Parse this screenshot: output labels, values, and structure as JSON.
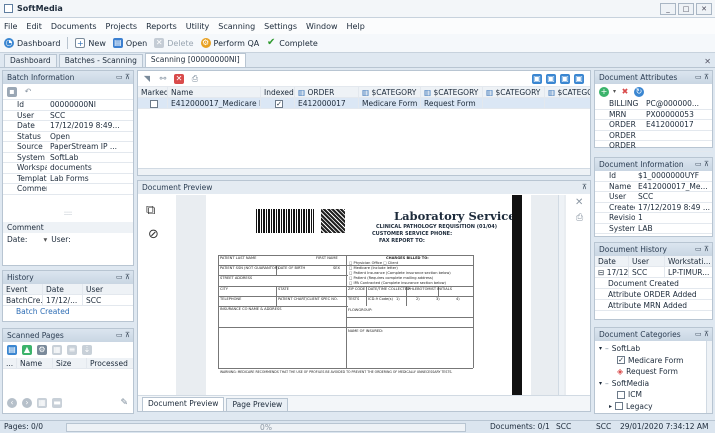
{
  "app": {
    "title": "SoftMedia"
  },
  "window_buttons": [
    "_",
    "□",
    "✕"
  ],
  "menu": [
    "File",
    "Edit",
    "Documents",
    "Projects",
    "Reports",
    "Utility",
    "Scanning",
    "Settings",
    "Window",
    "Help"
  ],
  "toolbar": {
    "dashboard": "Dashboard",
    "new": "New",
    "open": "Open",
    "delete": "Delete",
    "perform_qa": "Perform QA",
    "complete": "Complete"
  },
  "tabs": [
    "Dashboard",
    "Batches - Scanning",
    "Scanning [00000000NI]"
  ],
  "batch_info": {
    "title": "Batch Information",
    "rows": [
      {
        "k": "Id",
        "v": "00000000NI"
      },
      {
        "k": "User",
        "v": "SCC"
      },
      {
        "k": "Date",
        "v": "17/12/2019 8:49..."
      },
      {
        "k": "Status",
        "v": "Open"
      },
      {
        "k": "Source",
        "v": "PaperStream IP ..."
      },
      {
        "k": "System",
        "v": "SoftLab"
      },
      {
        "k": "Workspace",
        "v": "documents"
      },
      {
        "k": "Template",
        "v": "Lab Forms"
      },
      {
        "k": "Comment",
        "v": ""
      }
    ],
    "comment_label": "Comment",
    "date_label": "Date:",
    "user_label": "User:"
  },
  "history": {
    "title": "History",
    "columns": [
      "Event",
      "Date",
      "User"
    ],
    "rows": [
      {
        "event": "BatchCre...",
        "date": "17/12/...",
        "user": "SCC"
      }
    ],
    "sub": "Batch Created"
  },
  "scanned_pages": {
    "title": "Scanned Pages",
    "columns": [
      "...",
      "Name",
      "Size",
      "Processed"
    ]
  },
  "doc_grid": {
    "columns": [
      "Marked",
      "Name",
      "Indexed",
      "ORDER",
      "$CATEGORY",
      "$CATEGORY",
      "$CATEGORY",
      "$CATEGORY"
    ],
    "row": {
      "name": "E412000017_Medicare For...",
      "order": "E412000017",
      "cat1": "Medicare Form",
      "cat2": "Request Form"
    }
  },
  "preview": {
    "title": "Document Preview",
    "form": {
      "heading": "Laboratory Services",
      "sub1": "CLINICAL PATHOLOGY REQUISITION (01/04)",
      "sub2": "CUSTOMER SERVICE PHONE:",
      "sub3": "FAX REPORT TO:",
      "f_patient_last": "PATIENT LAST NAME",
      "f_first": "FIRST NAME",
      "f_charges": "CHARGES BILLED TO:",
      "f_ssn": "PATIENT SSN (NOT GUARANTOR)",
      "f_dob": "DATE OF BIRTH",
      "f_sex": "SEX",
      "f_street": "STREET ADDRESS",
      "f_city": "CITY",
      "f_state": "STATE",
      "f_zip": "ZIP CODE",
      "f_datetime": "DATE/TIME COLLECTED",
      "f_phleb": "PHLEBOTOMIST INITIALS",
      "f_phone": "TELEPHONE",
      "f_chart": "PATIENT CHART/CLIENT SPEC NO.",
      "f_tests": "TESTS",
      "f_icd": "ICD-9 Code(s)",
      "f_insurance": "INSURANCE CO NAME & ADDRESS",
      "f_flowgroup": "FLOWGROUP:",
      "f_insured": "NAME OF INSURED:",
      "footer": "WARNING: MEDICARE RECOMMENDS THAT THE USE OF PROFILES BE AVOIDED TO PREVENT THE ORDERING OF MEDICALLY UNNECESSARY TESTS.",
      "cb1": "Physician Office",
      "cb1b": "Client",
      "cb2": "Medicare (Include letter)",
      "cb3": "Patient Insurance (Complete insurance section below)",
      "cb4": "Patient (Requires complete mailing address)",
      "cb5": "IPA Contracted (Complete insurance section below)",
      "i1": "1)",
      "i2": "2)",
      "i3": "3)",
      "i4": "4)"
    },
    "bottom_tabs": [
      "Document Preview",
      "Page Preview"
    ]
  },
  "doc_attributes": {
    "title": "Document Attributes",
    "rows": [
      {
        "k": "BILLING",
        "v": "PC@000000..."
      },
      {
        "k": "MRN",
        "v": "PX00000053"
      },
      {
        "k": "ORDER",
        "v": "E412000017"
      },
      {
        "k": "ORDER",
        "v": ""
      },
      {
        "k": "ORDER",
        "v": ""
      }
    ]
  },
  "doc_info": {
    "title": "Document Information",
    "rows": [
      {
        "k": "Id",
        "v": "$1_0000000UYF"
      },
      {
        "k": "Name",
        "v": "E412000017_Me..."
      },
      {
        "k": "User",
        "v": "SCC"
      },
      {
        "k": "Created",
        "v": "17/12/2019 8:49 ..."
      },
      {
        "k": "Revision",
        "v": "1"
      },
      {
        "k": "System",
        "v": "LAB"
      }
    ]
  },
  "doc_history": {
    "title": "Document History",
    "columns": [
      "Date",
      "User",
      "Workstati..."
    ],
    "row": {
      "date": "17/12/...",
      "user": "SCC",
      "ws": "LP-TIMUR..."
    },
    "items": [
      "Document Created",
      "Attribute ORDER Added",
      "Attribute MRN Added"
    ]
  },
  "doc_categories": {
    "title": "Document Categories",
    "tree": [
      {
        "label": "SoftLab",
        "level": 0,
        "checked": false
      },
      {
        "label": "Medicare Form",
        "level": 1,
        "checked": true
      },
      {
        "label": "Request Form",
        "level": 1,
        "checked": false
      },
      {
        "label": "SoftMedia",
        "level": 0,
        "checked": false
      },
      {
        "label": "ICM",
        "level": 1,
        "checked": false
      },
      {
        "label": "Legacy",
        "level": 1,
        "checked": false
      }
    ]
  },
  "status": {
    "pages": "Pages: 0/0",
    "progress": "0%",
    "documents": "Documents: 0/1",
    "user1": "SCC",
    "user2": "SCC",
    "datetime": "29/01/2020 7:34:12 AM"
  },
  "colors": {
    "accent": "#2f6eb5",
    "header": "#c9d6e3",
    "selected_row": "#dbe7f5"
  }
}
